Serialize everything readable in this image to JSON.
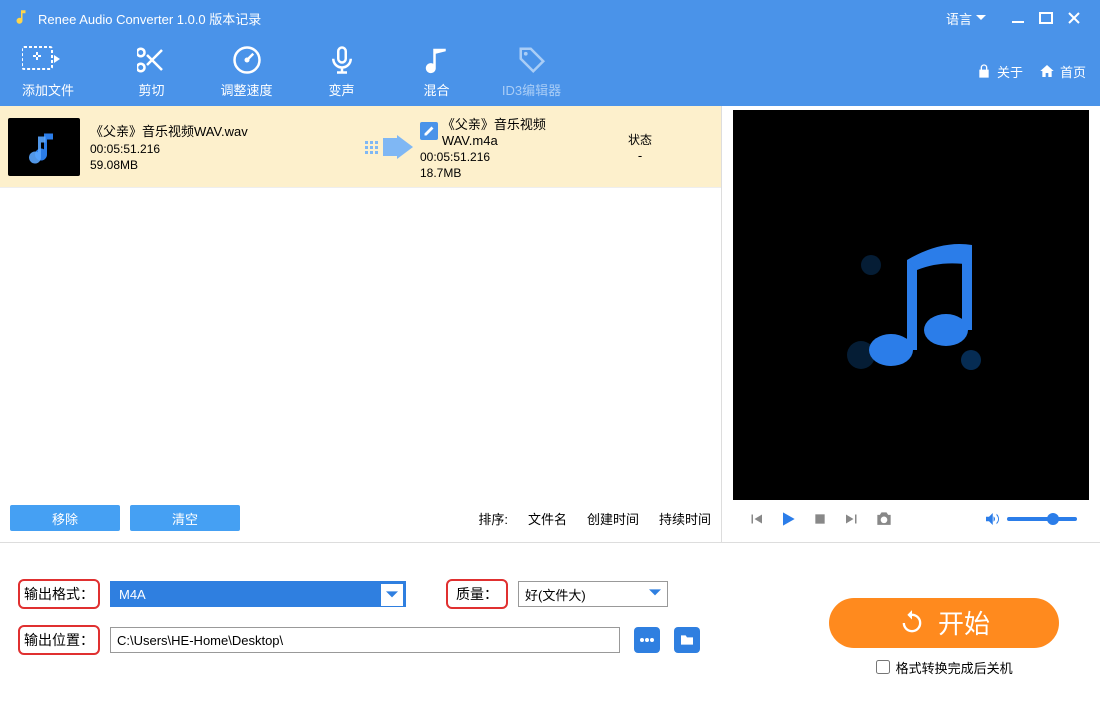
{
  "title": "Renee Audio Converter 1.0.0 版本记录",
  "titlebar": {
    "language": "语言"
  },
  "toolbar": {
    "add": "添加文件",
    "cut": "剪切",
    "speed": "调整速度",
    "voice": "变声",
    "mix": "混合",
    "id3": "ID3编辑器",
    "about": "关于",
    "home": "首页"
  },
  "file": {
    "src_name": "《父亲》音乐视频WAV.wav",
    "src_dur": "00:05:51.216",
    "src_size": "59.08MB",
    "dst_name": "《父亲》音乐视频WAV.m4a",
    "dst_dur": "00:05:51.216",
    "dst_size": "18.7MB",
    "state_hd": "状态",
    "state_val": "-"
  },
  "listctrl": {
    "remove": "移除",
    "clear": "清空",
    "sort_label": "排序:",
    "sort_name": "文件名",
    "sort_created": "创建时间",
    "sort_duration": "持续时间"
  },
  "form": {
    "out_format_label": "输出格式：",
    "out_format_value": "M4A",
    "quality_label": "质量：",
    "quality_value": "好(文件大)",
    "out_path_label": "输出位置：",
    "out_path_value": "C:\\Users\\HE-Home\\Desktop\\"
  },
  "action": {
    "start": "开始",
    "shutdown": "格式转换完成后关机"
  }
}
